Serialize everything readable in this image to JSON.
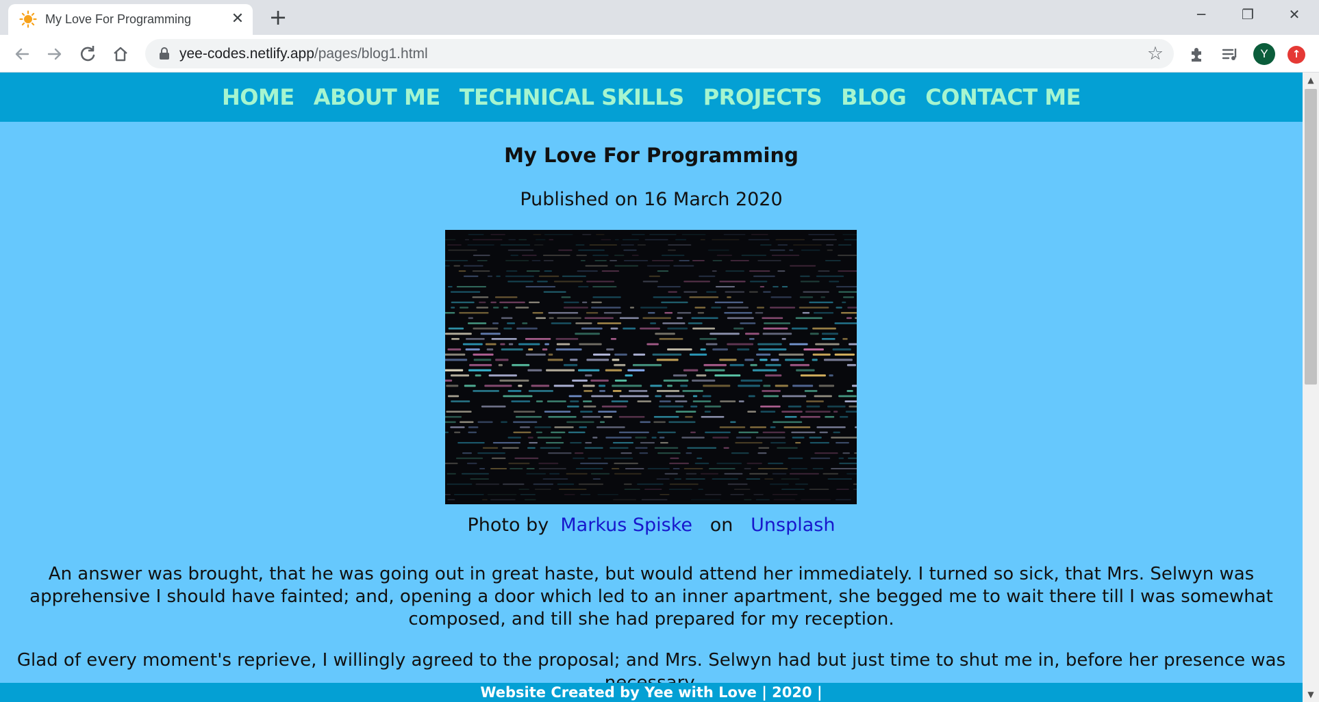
{
  "browser": {
    "tab_title": "My Love For Programming",
    "tab_close_glyph": "✕",
    "new_tab_glyph": "+",
    "url_host": "yee-codes.netlify.app",
    "url_path": "/pages/blog1.html",
    "profile_initial": "Y",
    "window_controls": {
      "minimize": "─",
      "maximize": "❐",
      "close": "✕"
    },
    "icons": [
      "back-arrow-icon",
      "forward-arrow-icon",
      "reload-icon",
      "home-icon",
      "lock-icon",
      "star-icon",
      "extensions-icon",
      "media-playlist-icon",
      "update-icon"
    ]
  },
  "site": {
    "nav": [
      "HOME",
      "ABOUT ME",
      "TECHNICAL SKILLS",
      "PROJECTS",
      "BLOG",
      "CONTACT ME"
    ],
    "post": {
      "title": "My Love For Programming",
      "date": "Published on 16 March 2020",
      "caption_prefix": "Photo by",
      "photographer": "Markus Spiske",
      "caption_mid": "on",
      "source": "Unsplash",
      "paragraph1": "An answer was brought, that he was going out in great haste, but would attend her immediately. I turned so sick, that Mrs. Selwyn was apprehensive I should have fainted; and, opening a door which led to an inner apartment, she begged me to wait there till I was somewhat composed, and till she had prepared for my reception.",
      "paragraph2": "Glad of every moment's reprieve, I willingly agreed to the proposal; and Mrs. Selwyn had but just time to shut me in, before her presence was necessary."
    },
    "footer": "Website Created by Yee with Love | 2020 |"
  },
  "colors": {
    "nav_bg": "#04a0d4",
    "nav_text": "#a6f5cf",
    "page_bg": "#66c8fd",
    "link": "#1717cc"
  }
}
